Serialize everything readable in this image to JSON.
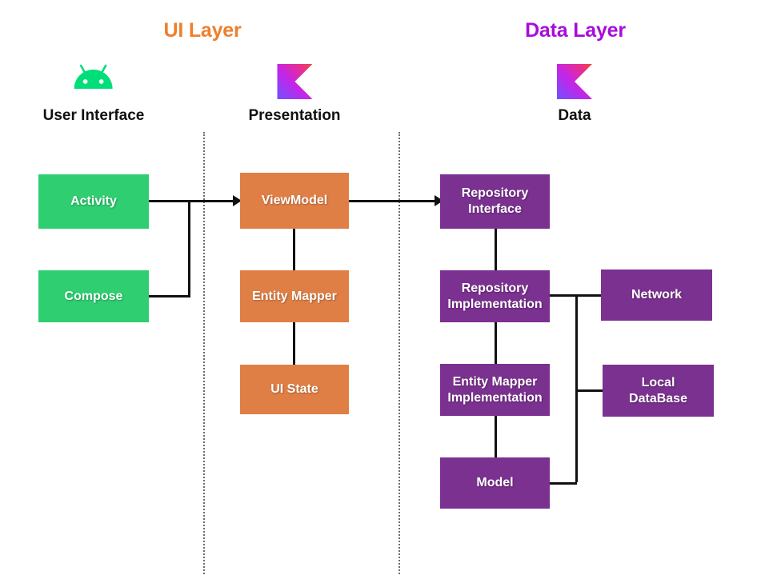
{
  "layers": {
    "ui": {
      "title": "UI Layer",
      "color": "#ee7f2d"
    },
    "data": {
      "title": "Data Layer",
      "color": "#a80cdb"
    }
  },
  "columns": [
    {
      "id": "user-interface",
      "label": "User Interface",
      "icon": "android-logo"
    },
    {
      "id": "presentation",
      "label": "Presentation",
      "icon": "kotlin-logo"
    },
    {
      "id": "data",
      "label": "Data",
      "icon": "kotlin-logo"
    }
  ],
  "nodes": {
    "activity": {
      "label": "Activity",
      "color": "#2ece71"
    },
    "compose": {
      "label": "Compose",
      "color": "#2ece71"
    },
    "viewmodel": {
      "label": "ViewModel",
      "color": "#e07f45"
    },
    "entity_mapper": {
      "label": "Entity Mapper",
      "color": "#e07f45"
    },
    "ui_state": {
      "label": "UI State",
      "color": "#e07f45"
    },
    "repo_interface": {
      "label": "Repository\nInterface",
      "color": "#7b3190"
    },
    "repo_impl": {
      "label": "Repository\nImplementation",
      "color": "#7b3190"
    },
    "entity_mapper_impl": {
      "label": "Entity Mapper\nImplementation",
      "color": "#7b3190"
    },
    "model": {
      "label": "Model",
      "color": "#7b3190"
    },
    "network": {
      "label": "Network",
      "color": "#7b3190"
    },
    "local_database": {
      "label": "Local\nDataBase",
      "color": "#7b3190"
    }
  },
  "palette": {
    "green": "#2ece71",
    "orange": "#e07f45",
    "purple": "#7b3190",
    "ui_layer_title": "#ee7f2d",
    "data_layer_title": "#a80cdb",
    "connector": "#111111",
    "divider": "#6d6d6d",
    "background": "#ffffff"
  }
}
